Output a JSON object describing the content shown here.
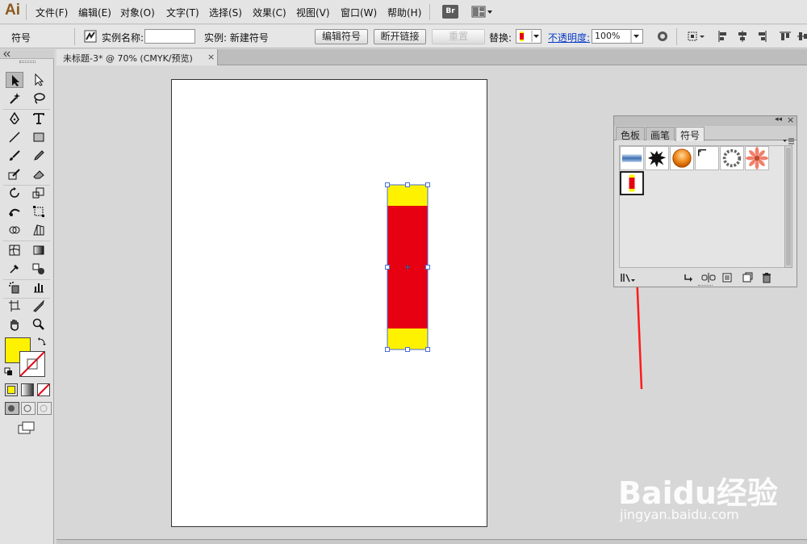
{
  "app": {
    "logo": "Ai",
    "menu": [
      "文件(F)",
      "编辑(E)",
      "对象(O)",
      "文字(T)",
      "选择(S)",
      "效果(C)",
      "视图(V)",
      "窗口(W)",
      "帮助(H)"
    ],
    "bridge_badge": "Br"
  },
  "control_bar": {
    "object_type": "符号",
    "instance_name_label": "实例名称:",
    "instance_name_value": "",
    "instance_label": "实例: 新建符号",
    "edit_symbol": "编辑符号",
    "break_link": "断开链接",
    "reset": "重置",
    "replace_label": "替换:",
    "opacity_label": "不透明度:",
    "opacity_value": "100%"
  },
  "document": {
    "tab_title": "未标题-3* @ 70% (CMYK/预览)",
    "close": "×"
  },
  "symbol_panel": {
    "tabs": [
      "色板",
      "画笔",
      "符号"
    ],
    "active_tab": "符号",
    "collapse": "◂◂",
    "close": "×",
    "symbols": [
      "blue-banner",
      "ink-splat",
      "orange-sphere",
      "frame-corner",
      "laurel-ring",
      "daisy-flower",
      "new-symbol"
    ],
    "selected_symbol": "new-symbol"
  },
  "artwork": {
    "colors": {
      "yellow": "#fff200",
      "red": "#e60012",
      "selection": "#4a6fd6"
    }
  },
  "fill_color": "#fff200",
  "watermark": {
    "brand": "Baidu经验",
    "url": "jingyan.baidu.com"
  }
}
